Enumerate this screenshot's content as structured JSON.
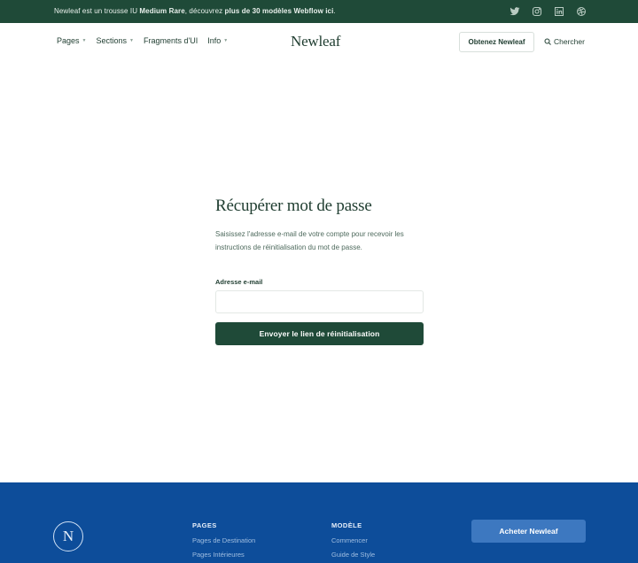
{
  "topbar": {
    "msg_pre": "Newleaf est un trousse IU ",
    "msg_brand": "Medium Rare",
    "msg_mid": ", découvrez ",
    "msg_link": "plus de 30 modèles Webflow ici",
    "msg_end": ".",
    "socials": [
      "twitter-icon",
      "instagram-icon",
      "linkedin-icon",
      "dribbble-icon"
    ]
  },
  "nav": {
    "items": [
      {
        "label": "Pages",
        "dropdown": true
      },
      {
        "label": "Sections",
        "dropdown": true
      },
      {
        "label": "Fragments d'UI",
        "dropdown": false
      },
      {
        "label": "Info",
        "dropdown": true
      }
    ],
    "logo": "Newleaf",
    "get_label": "Obtenez Newleaf",
    "search_label": "Chercher"
  },
  "form": {
    "title": "Récupérer mot de passe",
    "description": "Saisissez l'adresse e-mail de votre compte pour recevoir les instructions de réinitialisation du mot de passe.",
    "email_label": "Adresse e-mail",
    "email_value": "",
    "email_placeholder": "",
    "submit_label": "Envoyer le lien de réinitialisation"
  },
  "footer": {
    "badge_letter": "N",
    "columns": [
      {
        "heading": "PAGES",
        "links": [
          "Pages de Destination",
          "Pages Intérieures"
        ]
      },
      {
        "heading": "MODÈLE",
        "links": [
          "Commencer",
          "Guide de Style"
        ]
      }
    ],
    "buy_label": "Acheter Newleaf"
  },
  "colors": {
    "brand_green": "#1f4a38",
    "footer_blue": "#0d4d9a",
    "buy_button": "#3d78c0"
  }
}
